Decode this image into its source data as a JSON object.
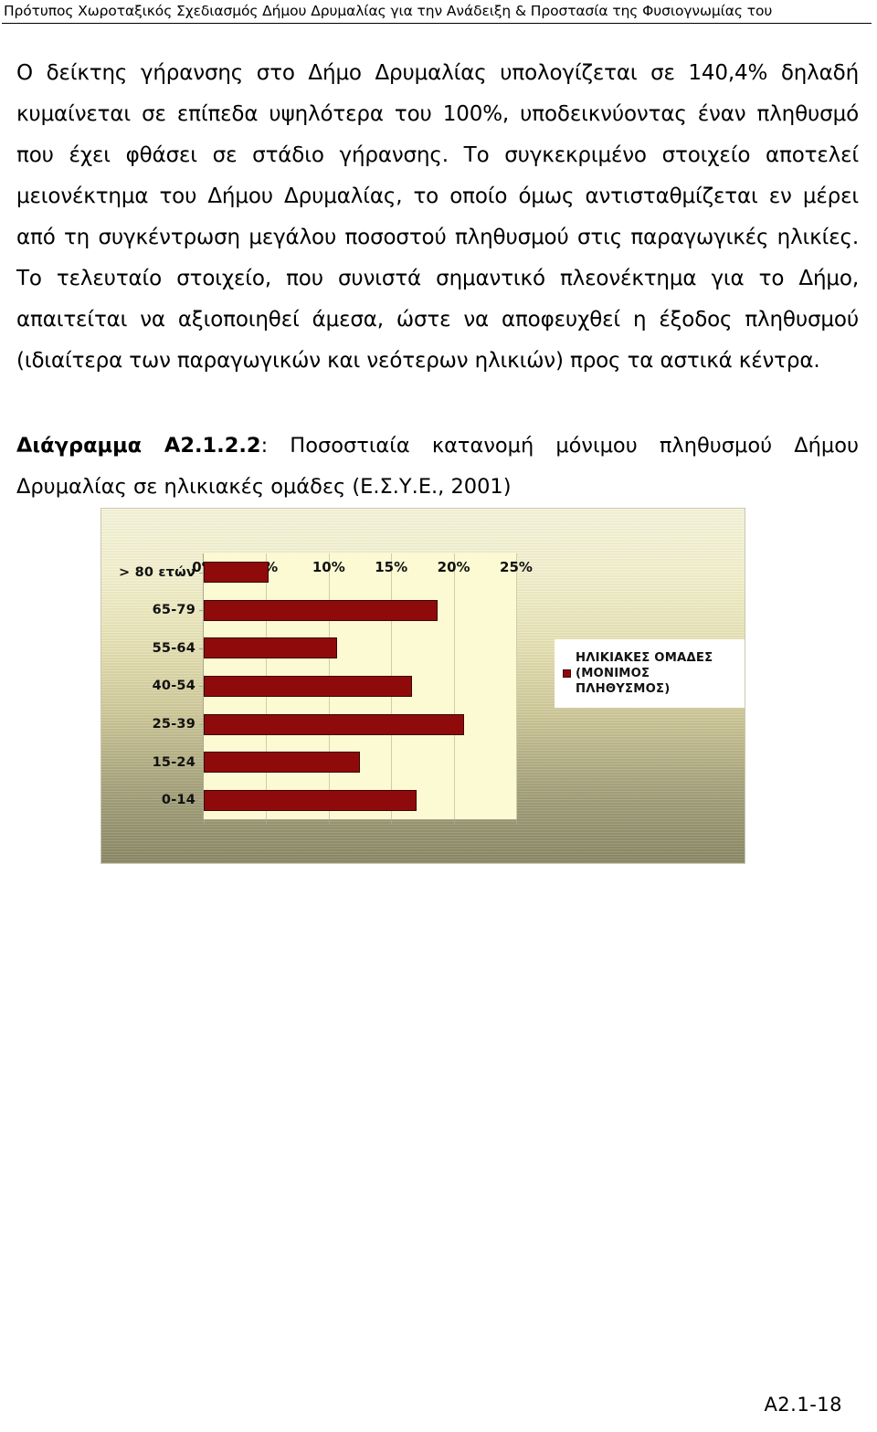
{
  "header": {
    "running_title": "Πρότυπος Χωροταξικός Σχεδιασμός Δήμου Δρυμαλίας για την Ανάδειξη & Προστασία της Φυσιογνωμίας του"
  },
  "body": {
    "paragraph": "Ο δείκτης γήρανσης στο Δήμο Δρυμαλίας υπολογίζεται σε 140,4% δηλαδή κυμαίνεται σε επίπεδα υψηλότερα του 100%, υποδεικνύοντας έναν πληθυσμό που έχει φθάσει σε στάδιο γήρανσης. Το συγκεκριμένο στοιχείο αποτελεί μειονέκτημα του Δήμου Δρυμαλίας, το οποίο όμως αντισταθμίζεται εν μέρει από τη συγκέντρωση μεγάλου ποσοστού πληθυσμού στις παραγωγικές ηλικίες. Το τελευταίο στοιχείο, που συνιστά σημαντικό πλεονέκτημα για το Δήμο, απαιτείται να αξιοποιηθεί άμεσα, ώστε να αποφευχθεί η έξοδος πληθυσμού (ιδιαίτερα των παραγωγικών και νεότερων ηλικιών) προς τα αστικά κέντρα."
  },
  "caption": {
    "label": "Διάγραμμα Α2.1.2.2",
    "text": ": Ποσοστιαία κατανομή μόνιμου πληθυσμού Δήμου Δρυμαλίας σε ηλικιακές ομάδες  (Ε.Σ.Υ.Ε., 2001)"
  },
  "chart_data": {
    "type": "bar",
    "orientation": "horizontal",
    "title": "",
    "xlabel": "",
    "ylabel": "",
    "categories": [
      "0-14",
      "15-24",
      "25-39",
      "40-54",
      "55-64",
      "65-79",
      "> 80 ετών"
    ],
    "values": [
      17.0,
      12.5,
      20.8,
      16.7,
      10.7,
      18.7,
      5.2
    ],
    "series": [
      {
        "name": "ΗΛΙΚΙΑΚΕΣ ΟΜΑΔΕΣ (ΜΟΝΙΜΟΣ ΠΛΗΘΥΣΜΟΣ)",
        "values": [
          17.0,
          12.5,
          20.8,
          16.7,
          10.7,
          18.7,
          5.2
        ]
      }
    ],
    "xlim": [
      0,
      25
    ],
    "xticks": [
      0,
      5,
      10,
      15,
      20,
      25
    ],
    "xtick_labels": [
      "0%",
      "5%",
      "10%",
      "15%",
      "20%",
      "25%"
    ],
    "grid": true,
    "grid_axis": "x",
    "legend_position": "right",
    "legend_entries": [
      {
        "label_line1": "ΗΛΙΚΙΑΚΕΣ ΟΜΑΔΕΣ",
        "label_line2": "(ΜΟΝΙΜΟΣ ΠΛΗΘΥΣΜΟΣ)",
        "color": "#8f0b0b"
      }
    ],
    "colors": {
      "bar_fill": "#8f0b0b",
      "bar_border": "#3a0505",
      "plot_background": "#fbfad3",
      "chart_background_top": "#f7f6dc",
      "chart_background_bottom": "#8c8a68",
      "gridline": "#cfcdab",
      "legend_background": "#ffffff"
    }
  },
  "footer": {
    "page_number": "A2.1-18"
  }
}
